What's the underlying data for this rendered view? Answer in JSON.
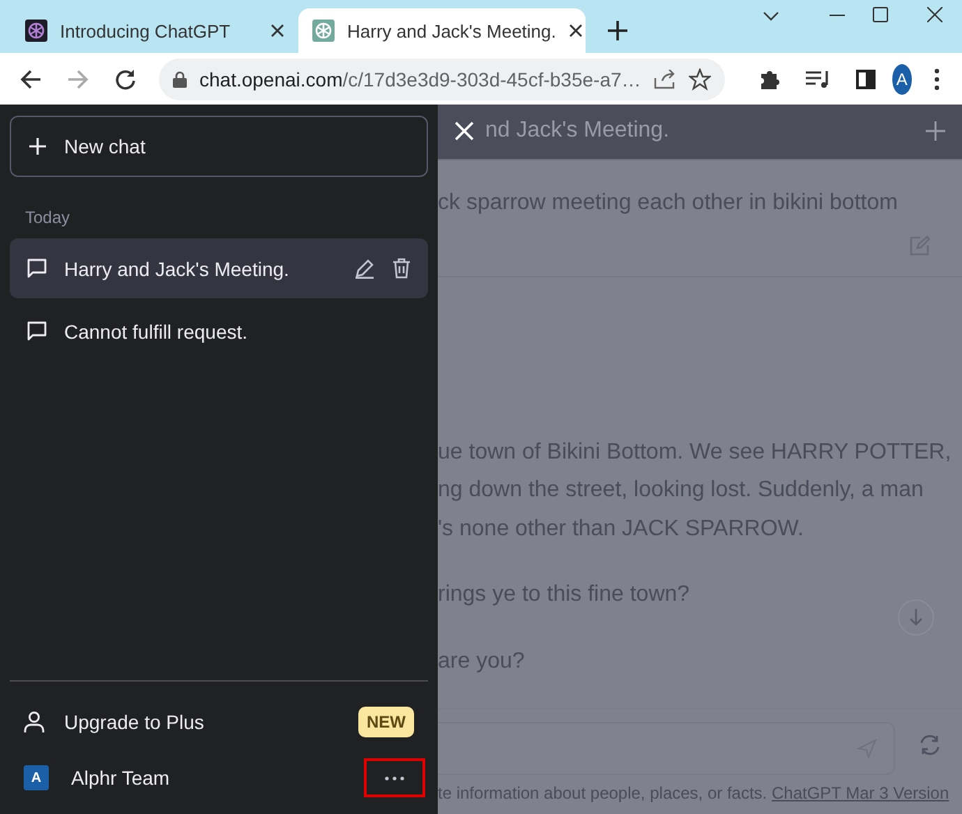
{
  "browser": {
    "tabs": [
      {
        "title": "Introducing ChatGPT",
        "selected": false
      },
      {
        "title": "Harry and Jack's Meeting.",
        "selected": true
      }
    ],
    "address": {
      "host": "chat.openai.com",
      "path": "/c/17d3e3d9-303d-45cf-b35e-a7…"
    },
    "profile_initial": "A"
  },
  "sidebar": {
    "new_chat": "New chat",
    "section": "Today",
    "chats": [
      {
        "title": "Harry and Jack's Meeting.",
        "selected": true
      },
      {
        "title": "Cannot fulfill request.",
        "selected": false
      }
    ],
    "upgrade": {
      "label": "Upgrade to Plus",
      "badge": "NEW"
    },
    "account": {
      "initial": "A",
      "name": "Alphr Team",
      "menu_highlighted": true
    }
  },
  "chat": {
    "title": "nd Jack's Meeting.",
    "prompt": "ck sparrow meeting each other in bikini bottom",
    "response": [
      [
        "ue town of Bikini Bottom. We see HARRY POTTER,",
        "ng down the street, looking lost. Suddenly, a man",
        "'s none other than JACK SPARROW."
      ],
      [
        "rings ye to this fine town?"
      ],
      [
        "are you?"
      ]
    ],
    "disclaimer": "te information about people, places, or facts.",
    "version_link": "ChatGPT Mar 3 Version"
  }
}
